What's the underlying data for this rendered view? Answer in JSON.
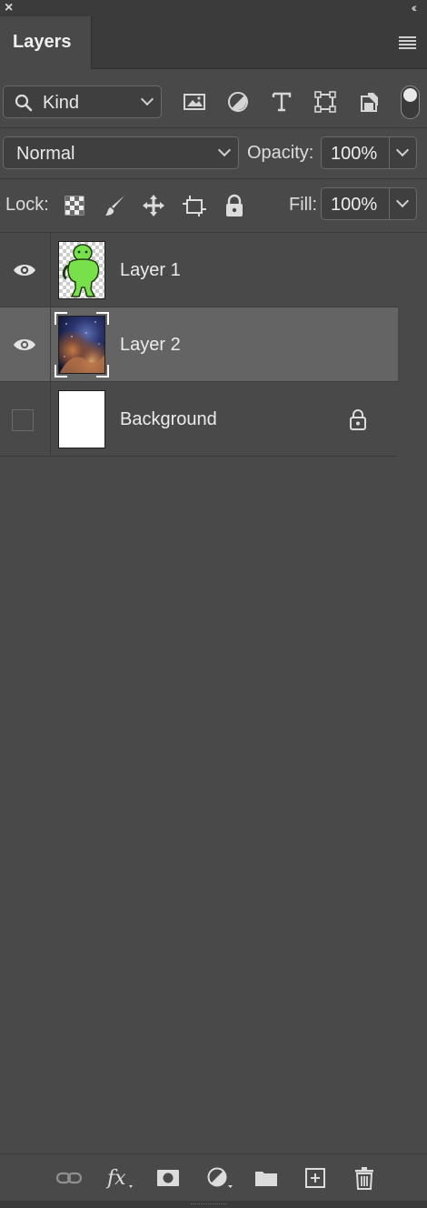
{
  "panel": {
    "close_glyph": "×",
    "collapse_glyph": "‹‹",
    "tab_label": "Layers"
  },
  "filter": {
    "kind_label": "Kind",
    "icons": [
      "image-filter-icon",
      "adjustment-filter-icon",
      "type-filter-icon",
      "shape-filter-icon",
      "smart-object-filter-icon"
    ],
    "filter_toggle": "on"
  },
  "blend": {
    "mode": "Normal",
    "opacity_label": "Opacity:",
    "opacity_value": "100%"
  },
  "lock": {
    "label": "Lock:",
    "icons": [
      "lock-transparent-pixels-icon",
      "lock-image-pixels-icon",
      "lock-position-icon",
      "lock-artboard-icon",
      "lock-all-icon"
    ],
    "fill_label": "Fill:",
    "fill_value": "100%"
  },
  "layers": [
    {
      "name": "Layer 1",
      "visible": true,
      "selected": false,
      "thumbnail": "green-figure-on-transparent"
    },
    {
      "name": "Layer 2",
      "visible": true,
      "selected": true,
      "thumbnail": "space-nebula"
    },
    {
      "name": "Background",
      "visible": false,
      "selected": false,
      "thumbnail": "white",
      "locked": true
    }
  ],
  "bottom_icons": [
    "link-layers-icon",
    "fx-icon",
    "add-mask-icon",
    "new-adjustment-layer-icon",
    "new-group-folder-icon",
    "new-layer-icon",
    "delete-layer-icon"
  ],
  "colors": {
    "panel_bg": "#494949",
    "selected_row": "#646464",
    "header_bg": "#3b3b3b"
  }
}
